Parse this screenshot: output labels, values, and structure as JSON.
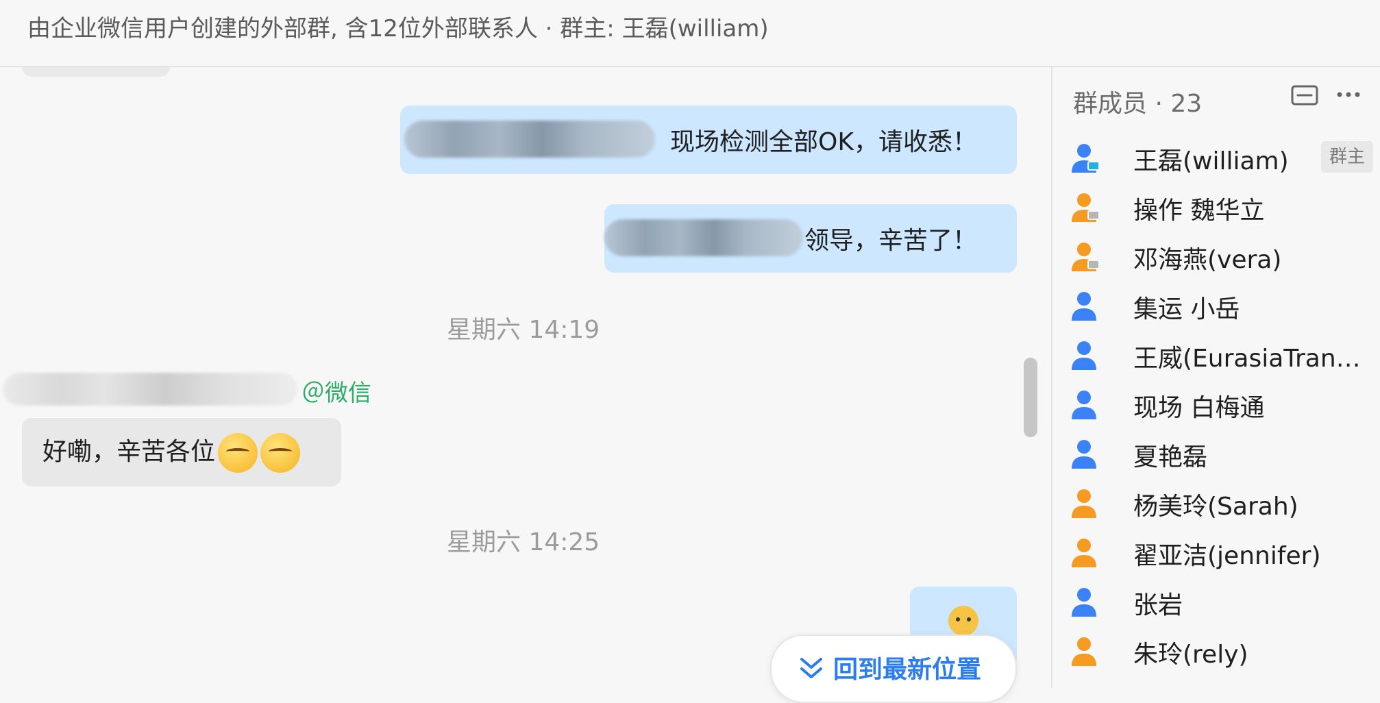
{
  "header": {
    "title": "由企业微信用户创建的外部群, 含12位外部联系人 · 群主: 王磊(william)"
  },
  "messages": [
    {
      "dir": "out",
      "text": "现场检测全部OK，请收悉！"
    },
    {
      "dir": "out",
      "text": "领导，辛苦了！"
    },
    {
      "type": "time",
      "text": "星期六 14:19"
    },
    {
      "dir": "in",
      "sender_tag": "＠微信",
      "text": "好嘞，辛苦各位",
      "emoji": [
        "thinking-face-emoji",
        "thinking-face-emoji"
      ]
    },
    {
      "type": "time",
      "text": "星期六 14:25"
    },
    {
      "dir": "out",
      "sticker": "person-sticker"
    }
  ],
  "jump_button": {
    "label": "回到最新位置",
    "icon": "double-chevron-down-icon",
    "color": "#2a7cf0"
  },
  "members_panel": {
    "title": "群成员 · 23",
    "icons": [
      "mail-icon",
      "more-icon"
    ],
    "owner_badge": "群主",
    "members": [
      {
        "name": "王磊(william)",
        "color": "#3b82f6",
        "badge": "pc"
      },
      {
        "name": "操作 魏华立",
        "color": "#f59a23",
        "badge": "pc"
      },
      {
        "name": "邓海燕(vera)",
        "color": "#f59a23",
        "badge": "pc"
      },
      {
        "name": "集运 小岳",
        "color": "#3b82f6"
      },
      {
        "name": "王威(EurasiaTransp...",
        "color": "#3b82f6"
      },
      {
        "name": "现场 白梅通",
        "color": "#3b82f6"
      },
      {
        "name": "夏艳磊",
        "color": "#3b82f6"
      },
      {
        "name": "杨美玲(Sarah)",
        "color": "#f59a23"
      },
      {
        "name": "翟亚洁(jennifer)",
        "color": "#f59a23"
      },
      {
        "name": "张岩",
        "color": "#3b82f6"
      },
      {
        "name": "朱玲(rely)",
        "color": "#f59a23"
      }
    ]
  },
  "colors": {
    "out_bubble": "#cce7ff",
    "in_bubble": "#e8e8e8",
    "wechat_green": "#2aae67"
  }
}
